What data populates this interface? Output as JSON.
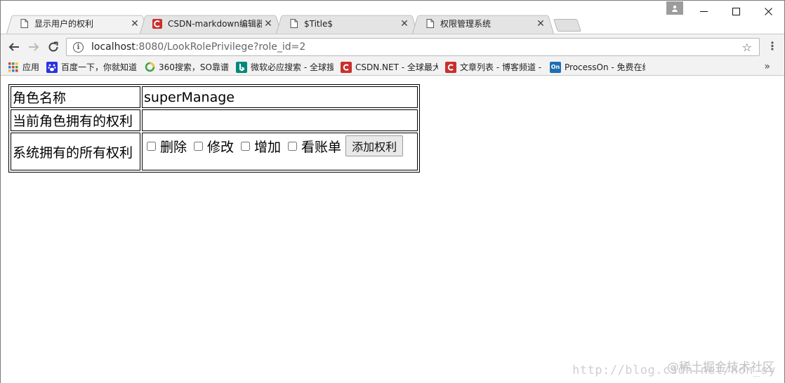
{
  "browser": {
    "tabs": [
      {
        "title": "显示用户的权利",
        "icon": "page-icon",
        "active": true
      },
      {
        "title": "CSDN-markdown编辑器",
        "icon": "csdn-icon",
        "active": false
      },
      {
        "title": "$Title$",
        "icon": "page-icon",
        "active": false
      },
      {
        "title": "权限管理系统",
        "icon": "page-icon",
        "active": false
      }
    ],
    "close_glyph": "✕",
    "url_host": "localhost",
    "url_path": ":8080/LookRolePrivilege?role_id=2",
    "bookmarks": [
      {
        "label": "应用",
        "icon": "apps-icon"
      },
      {
        "label": "百度一下，你就知道",
        "icon": "baidu-icon"
      },
      {
        "label": "360搜索，SO靠谱",
        "icon": "360-icon"
      },
      {
        "label": "微软必应搜索 - 全球搜",
        "icon": "bing-icon"
      },
      {
        "label": "CSDN.NET - 全球最大",
        "icon": "csdn-icon"
      },
      {
        "label": "文章列表 - 博客频道 -",
        "icon": "csdn-icon"
      },
      {
        "label": "ProcessOn - 免费在线",
        "icon": "processon-icon"
      }
    ],
    "overflow_glyph": "»"
  },
  "page": {
    "rows": {
      "role_name_label": "角色名称",
      "role_name_value": "superManage",
      "current_privileges_label": "当前角色拥有的权利",
      "current_privileges_value": "",
      "all_privileges_label": "系统拥有的所有权利"
    },
    "privileges": [
      {
        "label": "删除",
        "checked": false
      },
      {
        "label": "修改",
        "checked": false
      },
      {
        "label": "增加",
        "checked": false
      },
      {
        "label": "看账单",
        "checked": false
      }
    ],
    "add_button_label": "添加权利"
  },
  "watermark": {
    "url_text": "http://blog.csdn.net/non_sy",
    "brand_text": "@稀土掘金技术社区"
  },
  "colors": {
    "csdn_red": "#c9302c",
    "bing_teal": "#00897b",
    "processon_blue": "#1f6fb2",
    "baidu_blue": "#2932e1"
  }
}
